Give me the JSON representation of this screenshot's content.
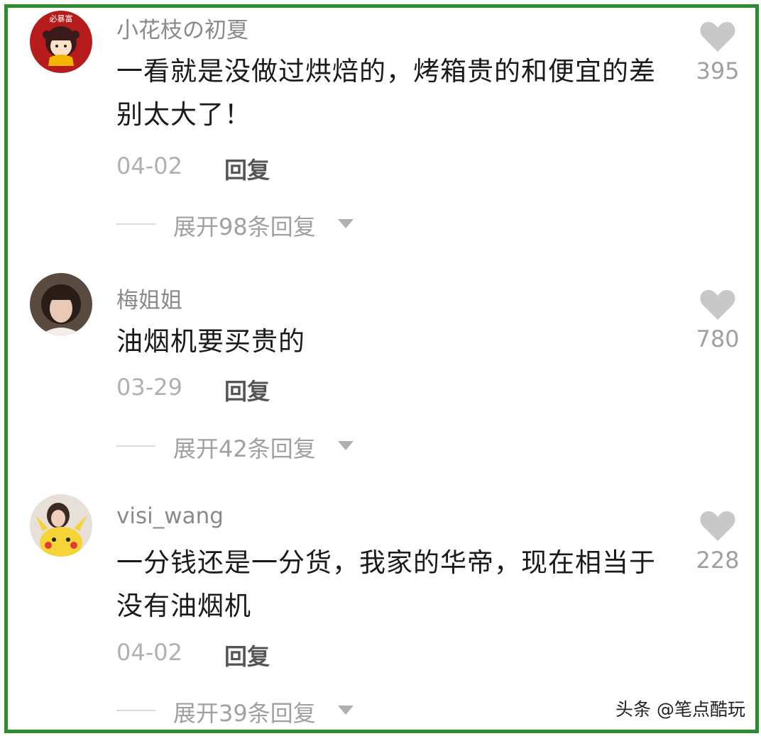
{
  "comments": [
    {
      "username": "小花枝の初夏",
      "text": "一看就是没做过烘焙的，烤箱贵的和便宜的差别太大了！",
      "date": "04-02",
      "reply_label": "回复",
      "expand_label": "展开98条回复",
      "likes": "395",
      "avatar_caption": "必暴富",
      "avatar_icon": "cartoon-girl-avatar"
    },
    {
      "username": "梅姐姐",
      "text": "油烟机要买贵的",
      "date": "03-29",
      "reply_label": "回复",
      "expand_label": "展开42条回复",
      "likes": "780",
      "avatar_icon": "woman-photo-avatar"
    },
    {
      "username": "visi_wang",
      "text": "一分钱还是一分货，我家的华帝，现在相当于没有油烟机",
      "date": "04-02",
      "reply_label": "回复",
      "expand_label": "展开39条回复",
      "likes": "228",
      "avatar_icon": "pikachu-photo-avatar"
    }
  ],
  "watermark": "头条 @笔点酷玩",
  "colors": {
    "frame_border": "#2e8b2e",
    "heart": "#c8c8c8",
    "username": "#8a8a8a",
    "text": "#1a1a1a"
  }
}
